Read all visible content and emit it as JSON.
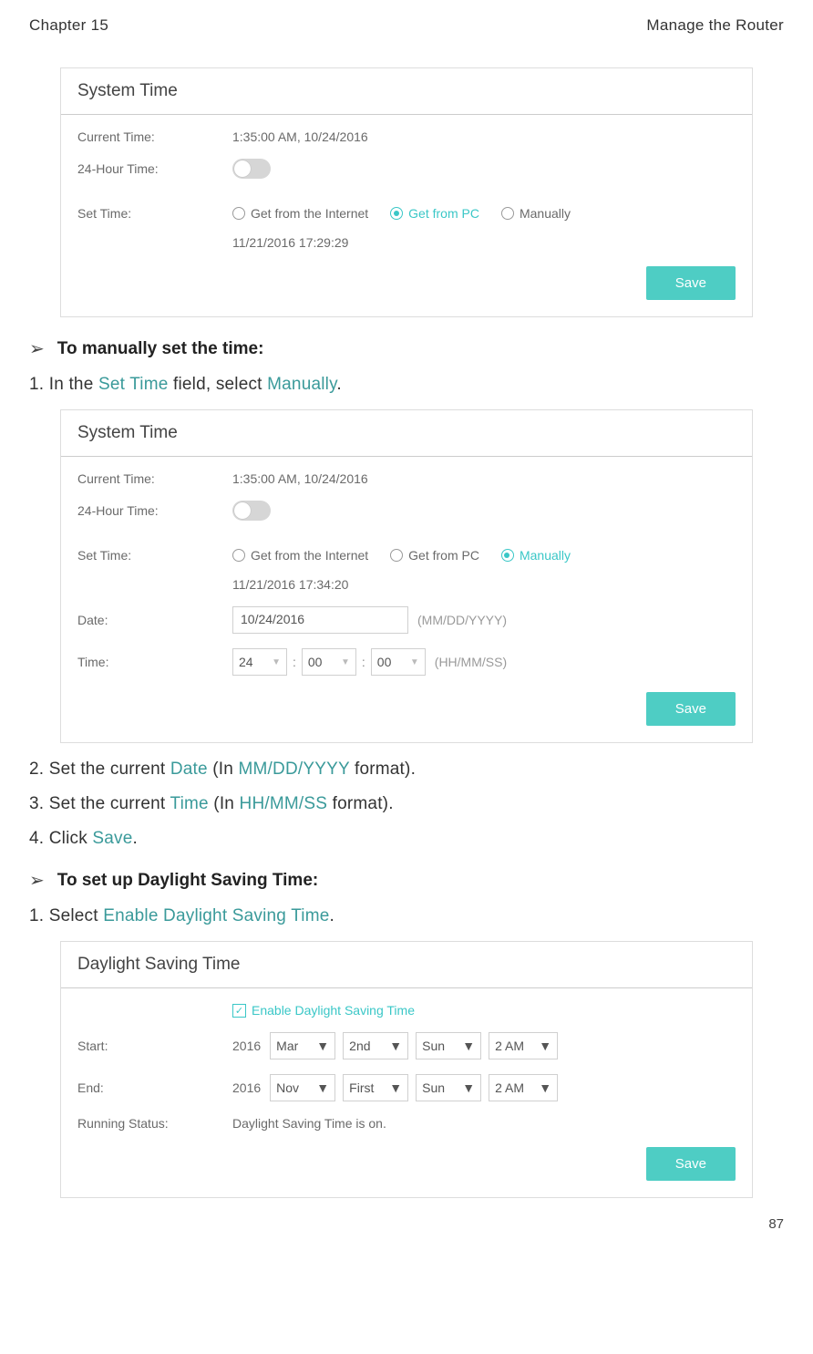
{
  "header": {
    "chapter": "Chapter 15",
    "section": "Manage the Router"
  },
  "panel1": {
    "title": "System Time",
    "current_time_label": "Current Time:",
    "current_time_value": "1:35:00 AM, 10/24/2016",
    "hour24_label": "24-Hour Time:",
    "set_time_label": "Set Time:",
    "radios": {
      "internet": "Get from the Internet",
      "pc": "Get from PC",
      "manual": "Manually"
    },
    "timestamp": "11/21/2016 17:29:29",
    "save": "Save"
  },
  "section1": {
    "title": "To manually set the time:",
    "step1_pre": "1. In the ",
    "step1_link1": "Set Time",
    "step1_mid": " field, select ",
    "step1_link2": "Manually",
    "step1_end": "."
  },
  "panel2": {
    "title": "System Time",
    "current_time_label": "Current Time:",
    "current_time_value": "1:35:00 AM, 10/24/2016",
    "hour24_label": "24-Hour Time:",
    "set_time_label": "Set Time:",
    "radios": {
      "internet": "Get from the Internet",
      "pc": "Get from PC",
      "manual": "Manually"
    },
    "timestamp": "11/21/2016 17:34:20",
    "date_label": "Date:",
    "date_value": "10/24/2016",
    "date_hint": "(MM/DD/YYYY)",
    "time_label": "Time:",
    "time_hh": "24",
    "time_mm": "00",
    "time_ss": "00",
    "time_hint": "(HH/MM/SS)",
    "save": "Save"
  },
  "steps": {
    "s2_pre": "2. Set the current ",
    "s2_l1": "Date",
    "s2_mid": " (In ",
    "s2_l2": "MM/DD/YYYY",
    "s2_end": " format).",
    "s3_pre": "3. Set the current ",
    "s3_l1": "Time",
    "s3_mid": " (In ",
    "s3_l2": "HH/MM/SS",
    "s3_end": " format).",
    "s4_pre": "4. Click ",
    "s4_l1": "Save",
    "s4_end": "."
  },
  "section2": {
    "title": "To set up Daylight Saving Time:",
    "step1_pre": "1. Select ",
    "step1_link": "Enable Daylight Saving Time",
    "step1_end": "."
  },
  "panel3": {
    "title": "Daylight Saving Time",
    "checkbox_label": "Enable Daylight Saving Time",
    "start_label": "Start:",
    "end_label": "End:",
    "year": "2016",
    "start": {
      "month": "Mar",
      "week": "2nd",
      "day": "Sun",
      "hour": "2 AM"
    },
    "end": {
      "month": "Nov",
      "week": "First",
      "day": "Sun",
      "hour": "2 AM"
    },
    "status_label": "Running Status:",
    "status_value": "Daylight Saving Time is on.",
    "save": "Save"
  },
  "page_number": "87"
}
